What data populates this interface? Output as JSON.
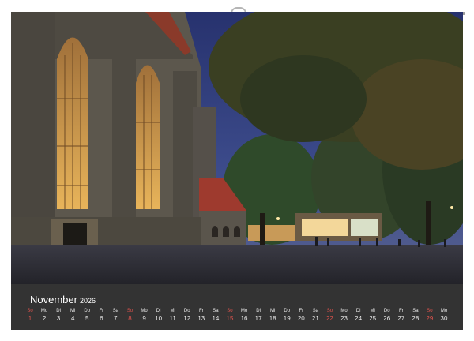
{
  "calendar": {
    "month": "November",
    "year": "2026",
    "days": [
      {
        "wd": "So",
        "n": "1",
        "sun": true
      },
      {
        "wd": "Mo",
        "n": "2"
      },
      {
        "wd": "Di",
        "n": "3"
      },
      {
        "wd": "Mi",
        "n": "4"
      },
      {
        "wd": "Do",
        "n": "5"
      },
      {
        "wd": "Fr",
        "n": "6"
      },
      {
        "wd": "Sa",
        "n": "7"
      },
      {
        "wd": "So",
        "n": "8",
        "sun": true
      },
      {
        "wd": "Mo",
        "n": "9"
      },
      {
        "wd": "Di",
        "n": "10"
      },
      {
        "wd": "Mi",
        "n": "11"
      },
      {
        "wd": "Do",
        "n": "12"
      },
      {
        "wd": "Fr",
        "n": "13"
      },
      {
        "wd": "Sa",
        "n": "14"
      },
      {
        "wd": "So",
        "n": "15",
        "sun": true
      },
      {
        "wd": "Mo",
        "n": "16"
      },
      {
        "wd": "Di",
        "n": "17"
      },
      {
        "wd": "Mi",
        "n": "18"
      },
      {
        "wd": "Do",
        "n": "19"
      },
      {
        "wd": "Fr",
        "n": "20"
      },
      {
        "wd": "Sa",
        "n": "21"
      },
      {
        "wd": "So",
        "n": "22",
        "sun": true
      },
      {
        "wd": "Mo",
        "n": "23"
      },
      {
        "wd": "Di",
        "n": "24"
      },
      {
        "wd": "Mi",
        "n": "25"
      },
      {
        "wd": "Do",
        "n": "26"
      },
      {
        "wd": "Fr",
        "n": "27"
      },
      {
        "wd": "Sa",
        "n": "28"
      },
      {
        "wd": "So",
        "n": "29",
        "sun": true
      },
      {
        "wd": "Mo",
        "n": "30"
      }
    ]
  },
  "colors": {
    "sunday": "#e0534d",
    "calendar_bg": "#333333",
    "sky": "#2d3a78"
  }
}
